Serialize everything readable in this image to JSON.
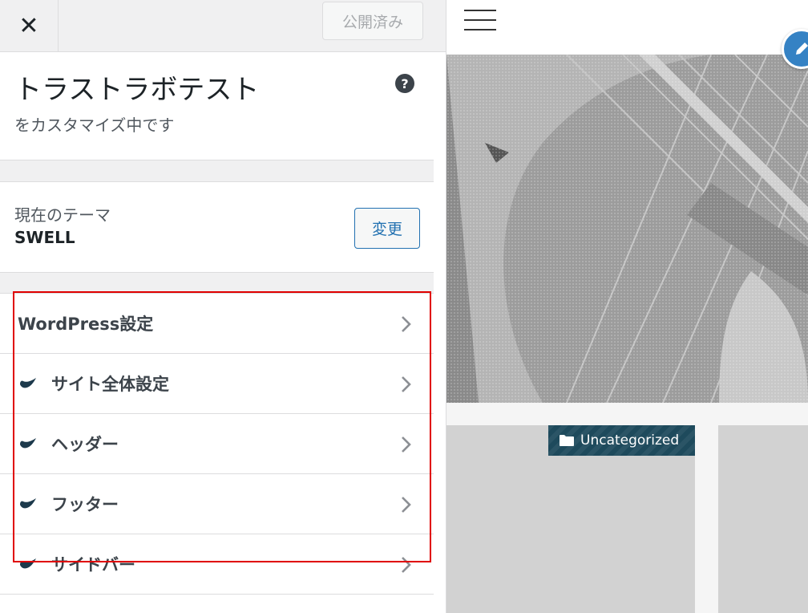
{
  "header": {
    "close_label": "✕",
    "publish_label": "公開済み"
  },
  "info": {
    "site_title": "トラストラボテスト",
    "subtitle": "をカスタマイズ中です",
    "help_label": "?"
  },
  "theme": {
    "label": "現在のテーマ",
    "name": "SWELL",
    "change_label": "変更"
  },
  "menu": {
    "items": [
      {
        "label": "WordPress設定",
        "branded": false
      },
      {
        "label": "サイト全体設定",
        "branded": true
      },
      {
        "label": "ヘッダー",
        "branded": true
      },
      {
        "label": "フッター",
        "branded": true
      },
      {
        "label": "サイドバー",
        "branded": true
      }
    ]
  },
  "preview": {
    "category_badge": "Uncategorized"
  },
  "colors": {
    "accent_blue": "#2271b1",
    "highlight_red": "#e00000",
    "badge_bg": "#1e4a5c",
    "swell_icon": "#1d3a4c"
  }
}
